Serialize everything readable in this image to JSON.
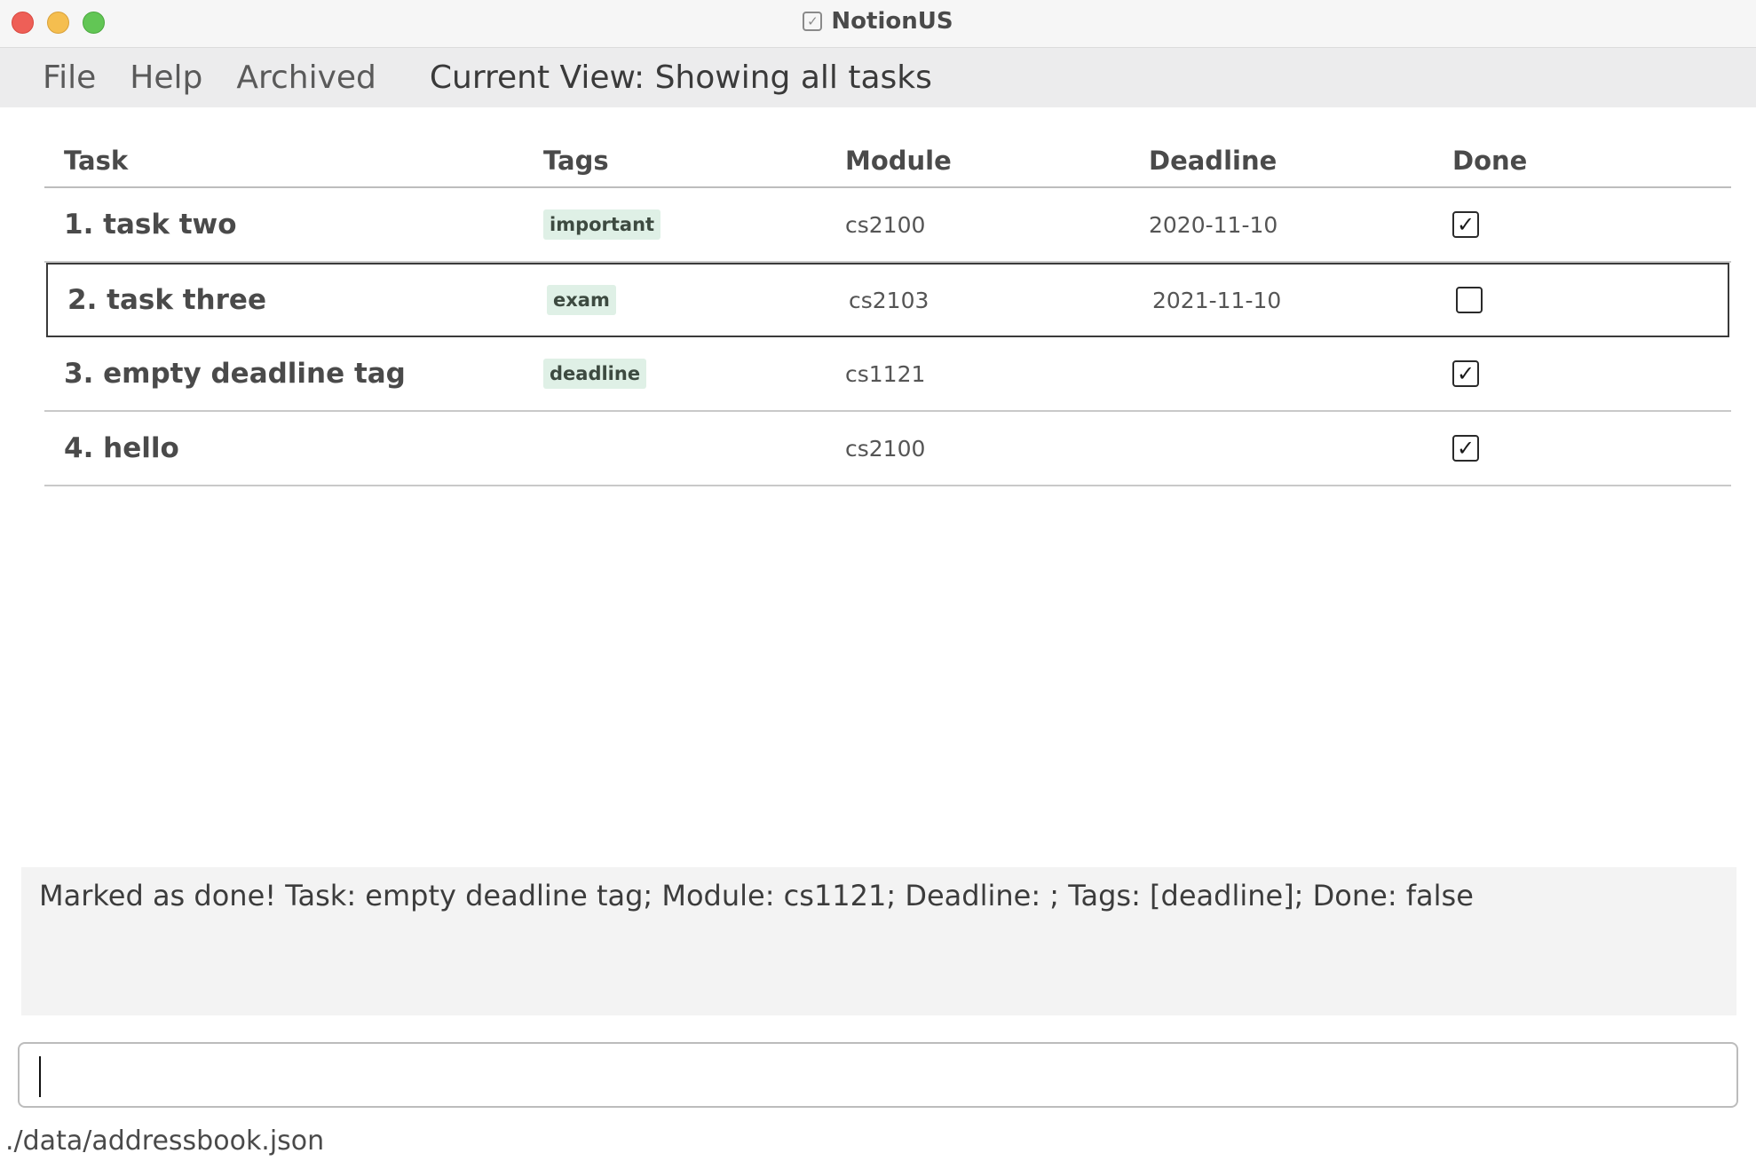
{
  "window": {
    "title": "NotionUS",
    "app_icon": "checkbox-icon"
  },
  "menu": {
    "items": [
      "File",
      "Help",
      "Archived"
    ],
    "current_view": "Current View: Showing all tasks"
  },
  "table": {
    "columns": [
      "Task",
      "Tags",
      "Module",
      "Deadline",
      "Done"
    ],
    "rows": [
      {
        "task": "1. task two",
        "tag": "important",
        "module": "cs2100",
        "deadline": "2020-11-10",
        "done": true,
        "selected": false
      },
      {
        "task": "2. task three",
        "tag": "exam",
        "module": "cs2103",
        "deadline": "2021-11-10",
        "done": false,
        "selected": true
      },
      {
        "task": "3. empty deadline tag",
        "tag": "deadline",
        "module": "cs1121",
        "deadline": "",
        "done": true,
        "selected": false
      },
      {
        "task": "4. hello",
        "tag": "",
        "module": "cs2100",
        "deadline": "",
        "done": true,
        "selected": false
      }
    ]
  },
  "result": {
    "message": "Marked as done! Task: empty deadline tag; Module: cs1121; Deadline: ; Tags: [deadline]; Done: false"
  },
  "command": {
    "value": "",
    "placeholder": ""
  },
  "status": {
    "file_path": "./data/addressbook.json"
  },
  "colors": {
    "tag_bg": "#dff0e6",
    "menubar_bg": "#ececed",
    "result_bg": "#f3f3f3"
  }
}
